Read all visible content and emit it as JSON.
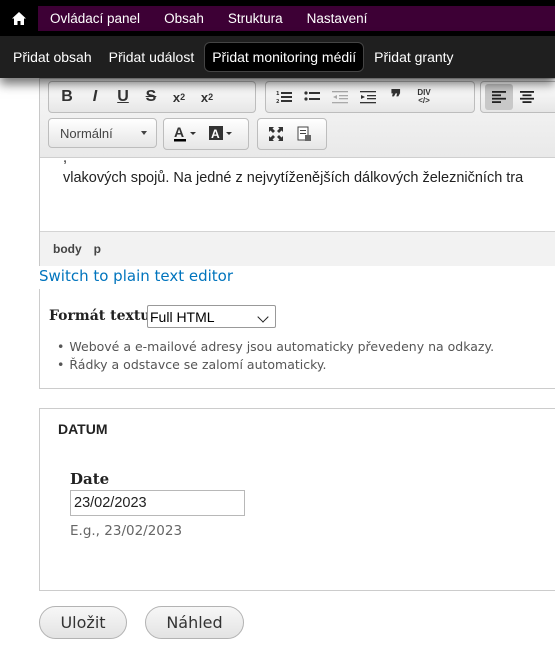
{
  "admin_menu": [
    "Ovládací panel",
    "Obsah",
    "Struktura",
    "Nastavení"
  ],
  "shortcuts": [
    {
      "label": "Přidat obsah",
      "active": false
    },
    {
      "label": "Přidat událost",
      "active": false
    },
    {
      "label": "Přidat monitoring médií",
      "active": true
    },
    {
      "label": "Přidat granty",
      "active": false
    }
  ],
  "toolbar": {
    "format_combo": "Normální",
    "buttons": [
      "bold-icon",
      "italic-icon",
      "underline-icon",
      "strikethrough-icon",
      "subscript-icon",
      "superscript-icon",
      "numbered-list-icon",
      "bulleted-list-icon",
      "outdent-icon",
      "indent-icon",
      "blockquote-icon",
      "div-container-icon",
      "align-left-icon",
      "align-center-icon",
      "text-color-icon",
      "background-color-icon",
      "maximize-icon",
      "source-icon"
    ]
  },
  "editor": {
    "text_line_partial": "                                                           ,",
    "text_line": "vlakových spojů. Na jedné z nejvytíženějších dálkových železničních tra",
    "path": [
      "body",
      "p"
    ]
  },
  "switch_link": "Switch to plain text editor",
  "text_format": {
    "label": "Formát textu",
    "selected": "Full HTML",
    "tips": [
      "Webové a e-mailové adresy jsou automaticky převedeny na odkazy.",
      "Řádky a odstavce se zalomí automaticky."
    ]
  },
  "datum": {
    "legend": "DATUM",
    "field_label": "Date",
    "value": "23/02/2023",
    "hint": "E.g., 23/02/2023"
  },
  "actions": {
    "save": "Uložit",
    "preview": "Náhled"
  }
}
